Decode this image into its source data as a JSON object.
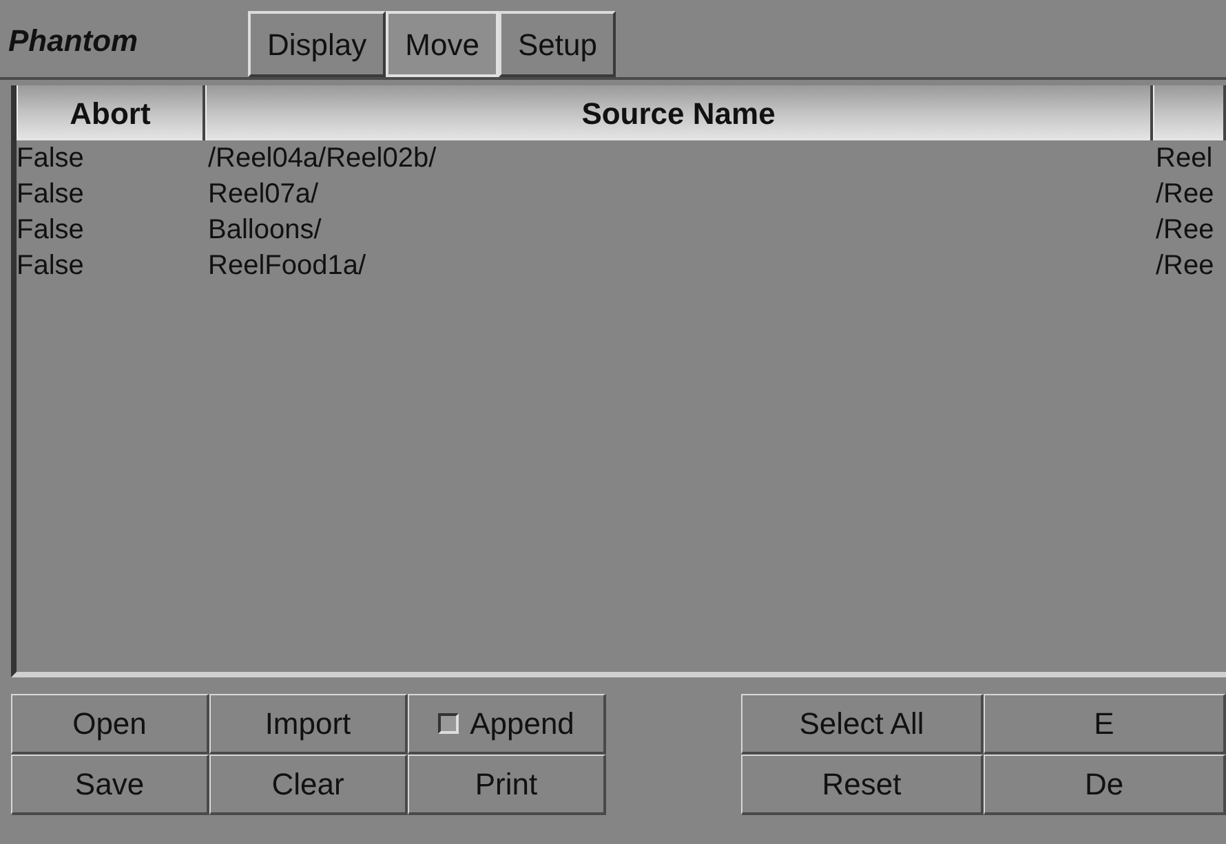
{
  "app_title": "Phantom",
  "tabs": [
    {
      "label": "Display",
      "selected": false
    },
    {
      "label": "Move",
      "selected": true
    },
    {
      "label": "Setup",
      "selected": false
    }
  ],
  "table": {
    "columns": [
      "Abort",
      "Source Name",
      ""
    ],
    "rows": [
      [
        "False",
        "/Reel04a/Reel02b/",
        "Reel"
      ],
      [
        "False",
        "Reel07a/",
        "/Ree"
      ],
      [
        "False",
        "Balloons/",
        "/Ree"
      ],
      [
        "False",
        "ReelFood1a/",
        "/Ree"
      ]
    ]
  },
  "left_buttons": [
    {
      "kind": "button",
      "label": "Open"
    },
    {
      "kind": "button",
      "label": "Import"
    },
    {
      "kind": "checkbox",
      "label": "Append",
      "checked": false
    },
    {
      "kind": "button",
      "label": "Save"
    },
    {
      "kind": "button",
      "label": "Clear"
    },
    {
      "kind": "button",
      "label": "Print"
    }
  ],
  "right_buttons": [
    {
      "label": "Select All"
    },
    {
      "label": "E"
    },
    {
      "label": "Reset"
    },
    {
      "label": "De"
    }
  ]
}
